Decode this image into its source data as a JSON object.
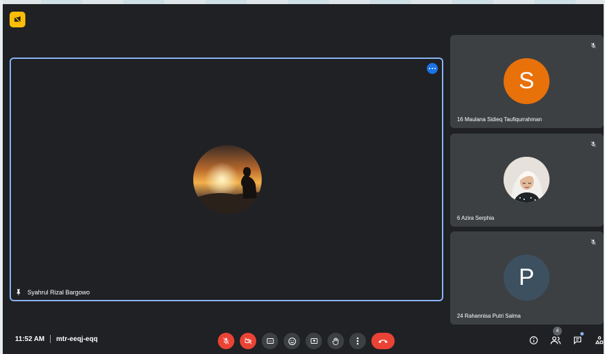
{
  "meeting": {
    "time": "11:52 AM",
    "code": "mtr-eeqj-eqq"
  },
  "main_tile": {
    "name": "Syahrul Rizal Bargowo",
    "pinned": true,
    "avatar_icon": "sunset-silhouette-photo"
  },
  "participants": [
    {
      "name": "16 Maulana Sidieq Taufiqurrahman",
      "initial": "S",
      "avatar_color": "#e8710a",
      "muted": true
    },
    {
      "name": "6 Azira Serphia",
      "initial": "",
      "avatar_icon": "hijab-portrait-photo",
      "muted": true
    },
    {
      "name": "24 Rahannisa Putri Salma",
      "initial": "P",
      "avatar_color": "#3d5060",
      "muted": true
    }
  ],
  "controls": [
    "mic-off",
    "camera-off",
    "captions",
    "emoji",
    "present",
    "raise-hand",
    "more",
    "leave-call"
  ],
  "side_panel": {
    "people_count": "4"
  },
  "colors": {
    "background": "#202124",
    "tile": "#3c4043",
    "accent": "#8ab4f8",
    "danger": "#ea4335"
  }
}
